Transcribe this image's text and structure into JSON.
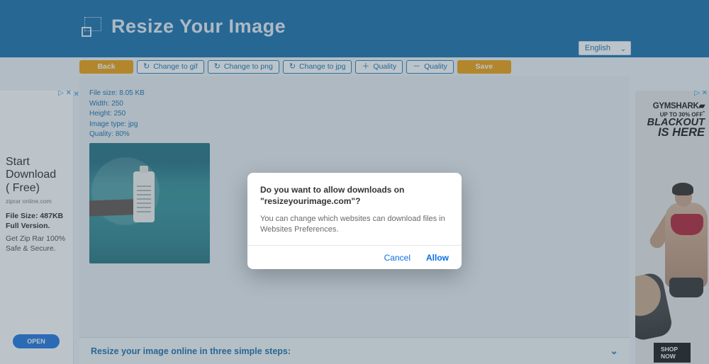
{
  "header": {
    "title": "Resize Your Image",
    "language": "English"
  },
  "toolbar": {
    "back": "Back",
    "change_gif": "Change to gif",
    "change_png": "Change to png",
    "change_jpg": "Change to jpg",
    "quality_plus": "Quality",
    "quality_minus": "Quality",
    "save": "Save"
  },
  "info": {
    "file_size_label": "File size:",
    "file_size_value": "8.05 KB",
    "width_label": "Width:",
    "width_value": "250",
    "height_label": "Height:",
    "height_value": "250",
    "image_type_label": "Image type:",
    "image_type_value": "jpg",
    "quality_label": "Quality:",
    "quality_value": "80%"
  },
  "footer": {
    "text": "Resize your image online in three simple steps:"
  },
  "ad_left": {
    "title_l1": "Start",
    "title_l2": "Download",
    "title_l3": "( Free)",
    "domain": "ziprar online.com",
    "line1": "File Size: 487KB",
    "line2": "Full Version.",
    "desc": "Get Zip Rar 100% Safe & Secure.",
    "cta": "OPEN"
  },
  "ad_right": {
    "brand": "GYMSHARK",
    "tag_prefix": "UP TO",
    "tag_bold": "30% OFF",
    "headline_l1": "BLACKOUT",
    "headline_l2": "IS HERE",
    "cta": "SHOP NOW"
  },
  "dialog": {
    "title": "Do you want to allow downloads on \"resizeyourimage.com\"?",
    "text": "You can change which websites can download files in Websites Preferences.",
    "cancel": "Cancel",
    "allow": "Allow"
  },
  "adchoices_glyph": "▷ ✕"
}
